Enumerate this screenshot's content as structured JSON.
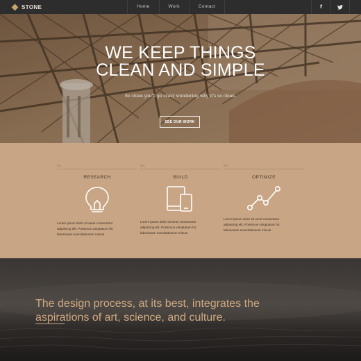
{
  "colors": {
    "accent": "#c9a36b",
    "nav_bg": "#2d2d2d",
    "feature_bg": "#c8a584",
    "quote_text": "#cfa982"
  },
  "nav": {
    "brand": "STONE",
    "brand_icon": "diamond-icon",
    "links": [
      "Home",
      "Work",
      "Contact"
    ],
    "social": [
      {
        "icon": "facebook-icon",
        "glyph": "f"
      },
      {
        "icon": "twitter-icon",
        "glyph": "🐦"
      }
    ]
  },
  "hero": {
    "title_line1": "WE KEEP THINGS",
    "title_line2": "CLEAN AND SIMPLE",
    "subtitle": "So clean you'll go crazy wondering why it's so clean.",
    "button": "SEE OUR WORK"
  },
  "features": [
    {
      "number": "001",
      "title": "RESEARCH",
      "icon": "lightbulb-icon",
      "text": [
        "Lorem ipsum dolor sit amet consectetur",
        "adipiscing elit. Possimus voluptatum hic",
        "laboriosam exercitationem minus!"
      ]
    },
    {
      "number": "002",
      "title": "BUILD",
      "icon": "devices-icon",
      "text": [
        "Lorem ipsum dolor sit amet consectetur",
        "adipiscing elit. Possimus voluptatum hic",
        "laboriosam exercitationem minus!"
      ]
    },
    {
      "number": "003",
      "title": "OPTIMIZE",
      "icon": "chart-line-icon",
      "text": [
        "Lorem ipsum dolor sit amet consectetur",
        "adipiscing elit. Possimus voluptatum hic",
        "laboriosam exercitationem minus!"
      ]
    }
  ],
  "quote": {
    "line1": "The design process, at its best, integrates the",
    "line2": "aspirations of art, science, and culture."
  }
}
